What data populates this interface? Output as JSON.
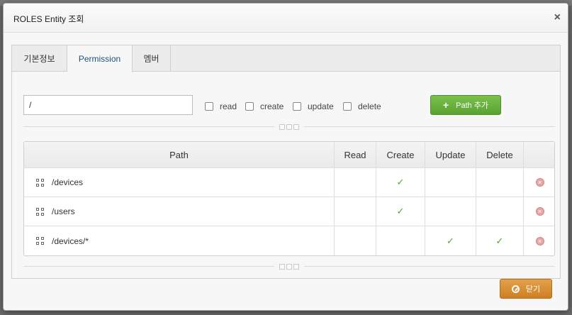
{
  "dialog": {
    "title": "ROLES Entity 조회",
    "close_icon": "×"
  },
  "tabs": [
    {
      "label": "기본정보"
    },
    {
      "label": "Permission"
    },
    {
      "label": "멤버"
    }
  ],
  "form": {
    "path_value": "/",
    "checkboxes": [
      {
        "label": "read"
      },
      {
        "label": "create"
      },
      {
        "label": "update"
      },
      {
        "label": "delete"
      }
    ],
    "add_button_label": "Path 추가",
    "add_button_icon": "+"
  },
  "table": {
    "headers": [
      "Path",
      "Read",
      "Create",
      "Update",
      "Delete"
    ],
    "rows": [
      {
        "path": "/devices",
        "read": "",
        "create": "✓",
        "update": "",
        "delete": ""
      },
      {
        "path": "/users",
        "read": "",
        "create": "✓",
        "update": "",
        "delete": ""
      },
      {
        "path": "/devices/*",
        "read": "",
        "create": "",
        "update": "✓",
        "delete": "✓"
      }
    ]
  },
  "footer": {
    "close_button_label": "닫기"
  },
  "colors": {
    "add_button": "#5aa331",
    "close_button": "#cf7f22",
    "check": "#4caa2a",
    "remove_icon": "#e5a8a8"
  }
}
